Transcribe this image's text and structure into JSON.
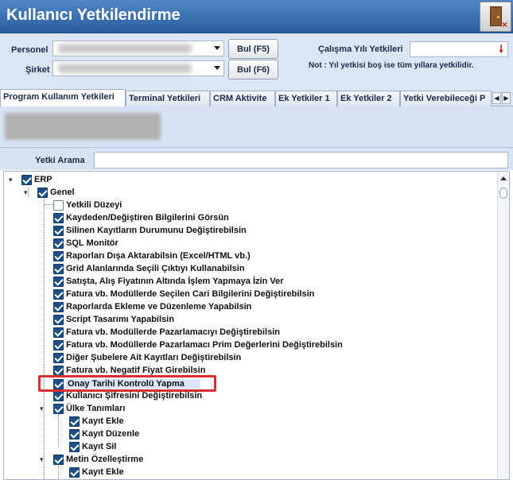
{
  "window": {
    "title": "Kullanıcı Yetkilendirme"
  },
  "header": {
    "personel_label": "Personel",
    "sirket_label": "Şirket",
    "bul_f5": "Bul (F5)",
    "bul_f6": "Bul (F6)",
    "year_label": "Çalışma Yılı Yetkileri",
    "year_value": "",
    "note": "Not : Yıl yetkisi boş ise tüm yıllara yetkilidir."
  },
  "tabs": [
    "Program Kullanım Yetkileri",
    "Terminal Yetkileri",
    "CRM Aktivite",
    "Ek Yetkiler 1",
    "Ek Yetkiler 2",
    "Yetki Verebileceği P"
  ],
  "search": {
    "label": "Yetki Arama",
    "value": ""
  },
  "tree": [
    {
      "label": "ERP",
      "level": 0,
      "checked": true,
      "expanded": true
    },
    {
      "label": "Genel",
      "level": 1,
      "checked": true,
      "expanded": true
    },
    {
      "label": "Yetkili Düzeyi",
      "level": 2,
      "checked": false
    },
    {
      "label": "Kaydeden/Değiştiren Bilgilerini Görsün",
      "level": 2,
      "checked": true
    },
    {
      "label": "Silinen Kayıtların Durumunu Değiştirebilsin",
      "level": 2,
      "checked": true
    },
    {
      "label": "SQL Monitör",
      "level": 2,
      "checked": true
    },
    {
      "label": "Raporları Dışa Aktarabilsin (Excel/HTML vb.)",
      "level": 2,
      "checked": true
    },
    {
      "label": "Grid Alanlarında Seçili Çıktıyı Kullanabilsin",
      "level": 2,
      "checked": true
    },
    {
      "label": "Satışta, Alış Fiyatının Altında İşlem Yapmaya İzin Ver",
      "level": 2,
      "checked": true
    },
    {
      "label": "Fatura vb. Modüllerde Seçilen Cari Bilgilerini Değiştirebilsin",
      "level": 2,
      "checked": true
    },
    {
      "label": "Raporlarda Ekleme ve Düzenleme Yapabilsin",
      "level": 2,
      "checked": true
    },
    {
      "label": "Script Tasarımı Yapabilsin",
      "level": 2,
      "checked": true
    },
    {
      "label": "Fatura vb. Modüllerde Pazarlamacıyı Değiştirebilsin",
      "level": 2,
      "checked": true
    },
    {
      "label": "Fatura vb. Modüllerde Pazarlamacı Prim Değerlerini Değiştirebilsin",
      "level": 2,
      "checked": true
    },
    {
      "label": "Diğer Şubelere Ait Kayıtları Değiştirebilsin",
      "level": 2,
      "checked": true
    },
    {
      "label": "Fatura vb. Negatif Fiyat Girebilsin",
      "level": 2,
      "checked": true
    },
    {
      "label": "Onay Tarihi Kontrolü Yapma",
      "level": 2,
      "checked": true,
      "highlighted": true
    },
    {
      "label": "Kullanıcı Şifresini Değiştirebilsin",
      "level": 2,
      "checked": true
    },
    {
      "label": "Ülke Tanımları",
      "level": 2,
      "checked": true,
      "expanded": true
    },
    {
      "label": "Kayıt Ekle",
      "level": 3,
      "checked": true
    },
    {
      "label": "Kayıt Düzenle",
      "level": 3,
      "checked": true
    },
    {
      "label": "Kayıt Sil",
      "level": 3,
      "checked": true
    },
    {
      "label": "Metin Özelleştirme",
      "level": 2,
      "checked": true,
      "expanded": true
    },
    {
      "label": "Kayıt Ekle",
      "level": 3,
      "checked": true
    }
  ]
}
